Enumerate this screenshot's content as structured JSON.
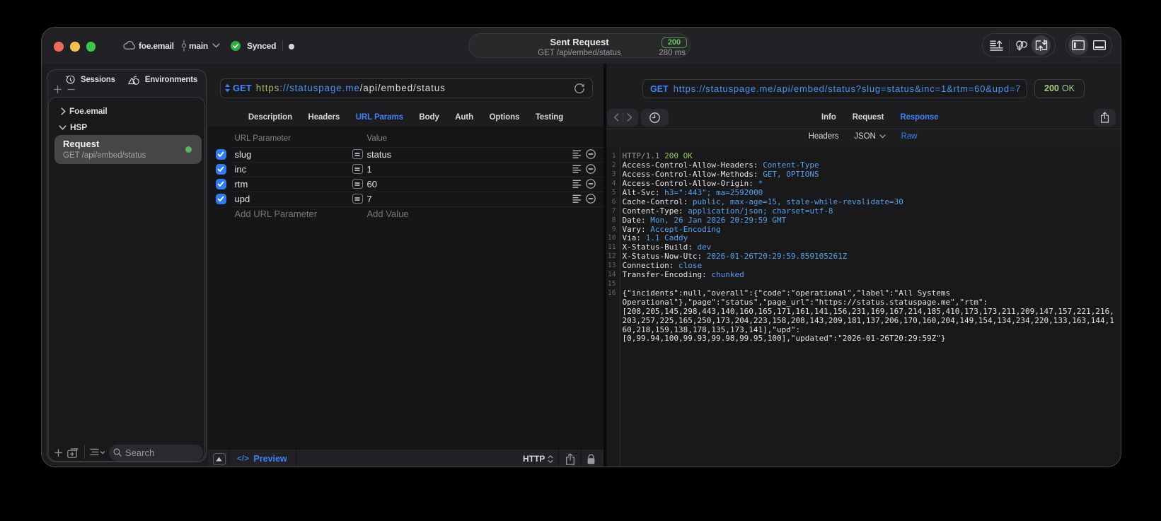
{
  "titlebar": {
    "project": "foe.email",
    "branch": "main",
    "sync_status": "Synced",
    "request_pill": {
      "title": "Sent Request",
      "subtitle": "GET /api/embed/status",
      "status_code": "200",
      "duration": "280 ms"
    }
  },
  "sidebar": {
    "tabs": [
      {
        "label": "Sessions"
      },
      {
        "label": "Environments"
      }
    ],
    "add_label": "+",
    "remove_label": "−",
    "tree": [
      {
        "label": "Foe.email",
        "expanded": false
      },
      {
        "label": "HSP",
        "expanded": true
      }
    ],
    "selected_request": {
      "title": "Request",
      "subtitle": "GET /api/embed/status"
    },
    "search": {
      "placeholder": "Search"
    }
  },
  "request_pane": {
    "method": "GET",
    "url_scheme": "https",
    "url_host": "://statuspage.me",
    "url_path": "/api/embed/status",
    "tabs": [
      "Description",
      "Headers",
      "URL Params",
      "Body",
      "Auth",
      "Options",
      "Testing"
    ],
    "active_tab": "URL Params",
    "params": {
      "col_param": "URL Parameter",
      "col_value": "Value",
      "rows": [
        {
          "name": "slug",
          "value": "status",
          "enabled": true
        },
        {
          "name": "inc",
          "value": "1",
          "enabled": true
        },
        {
          "name": "rtm",
          "value": "60",
          "enabled": true
        },
        {
          "name": "upd",
          "value": "7",
          "enabled": true
        }
      ],
      "add_param_placeholder": "Add URL Parameter",
      "add_value_placeholder": "Add Value"
    },
    "statusbar": {
      "code_glyph": "</>",
      "preview_label": "Preview",
      "protocol": "HTTP"
    }
  },
  "response_pane": {
    "method": "GET",
    "url": "https://statuspage.me/api/embed/status?slug=status&inc=1&rtm=60&upd=7",
    "status_code": "200",
    "status_text": "OK",
    "tabs": [
      "Info",
      "Request",
      "Response"
    ],
    "active_tab": "Response",
    "subtabs": [
      "Headers",
      "JSON",
      "Raw"
    ],
    "active_subtab": "Raw",
    "dropdown_subtab": "JSON",
    "status_line": {
      "protocol": "HTTP/1.1",
      "status": "200 OK"
    },
    "headers": [
      {
        "name": "Access-Control-Allow-Headers",
        "value": "Content-Type"
      },
      {
        "name": "Access-Control-Allow-Methods",
        "value": "GET, OPTIONS"
      },
      {
        "name": "Access-Control-Allow-Origin",
        "value": "*"
      },
      {
        "name": "Alt-Svc",
        "value": "h3=\":443\"; ma=2592000"
      },
      {
        "name": "Cache-Control",
        "value": "public, max-age=15, stale-while-revalidate=30"
      },
      {
        "name": "Content-Type",
        "value": "application/json; charset=utf-8"
      },
      {
        "name": "Date",
        "value": "Mon, 26 Jan 2026 20:29:59 GMT"
      },
      {
        "name": "Vary",
        "value": "Accept-Encoding"
      },
      {
        "name": "Via",
        "value": "1.1 Caddy"
      },
      {
        "name": "X-Status-Build",
        "value": "dev"
      },
      {
        "name": "X-Status-Now-Utc",
        "value": "2026-01-26T20:29:59.859105261Z"
      },
      {
        "name": "Connection",
        "value": "close"
      },
      {
        "name": "Transfer-Encoding",
        "value": "chunked"
      }
    ],
    "body_line_number": 16,
    "body_lines": [
      "{\"incidents\":null,\"overall\":{\"code\":\"operational\",\"label\":\"All Systems",
      "Operational\"},\"page\":\"status\",\"page_url\":\"https://status.statuspage.me\",\"rtm\":",
      "[208,205,145,298,443,140,160,165,171,161,141,156,231,169,167,214,185,410,173,173,211,209,147,157,221,216,",
      "203,257,225,165,250,173,204,223,158,208,143,209,181,137,206,170,160,204,149,154,134,234,220,133,163,144,1",
      "60,218,159,138,178,135,173,141],\"upd\":",
      "[0,99.94,100,99.93,99.98,99.95,100],\"updated\":\"2026-01-26T20:29:59Z\"}"
    ]
  },
  "colors": {
    "accent_blue": "#3e82f7",
    "mono_value_blue": "#57a0e6",
    "status_green": "#97c45e",
    "url_scheme_green": "#9cbb66",
    "checkbox_blue": "#2e7cf2",
    "traffic_red": "#ec6a5e",
    "traffic_yellow": "#f4bf4f",
    "traffic_green": "#3dc84c"
  }
}
